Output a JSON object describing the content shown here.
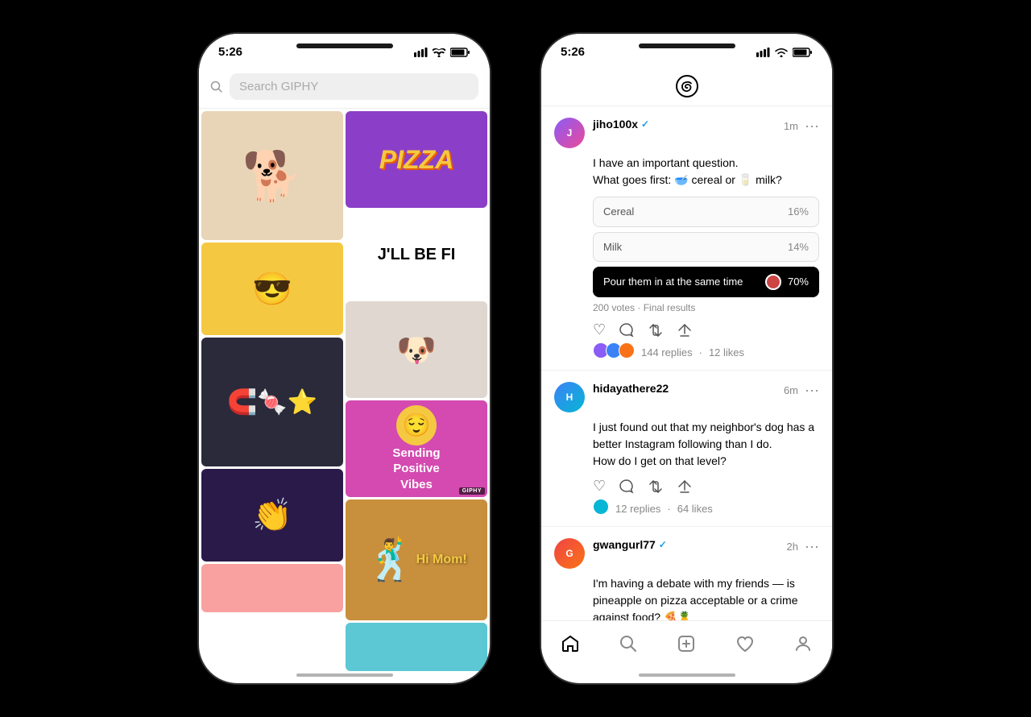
{
  "scene": {
    "bg_color": "#000000"
  },
  "giphy_phone": {
    "status_time": "5:26",
    "search_placeholder": "Search GIPHY",
    "gifs_col1": [
      {
        "id": "dog",
        "label": "Dog with glasses"
      },
      {
        "id": "girl",
        "label": "Girl with sunglasses"
      },
      {
        "id": "magnets",
        "label": "Magnet art"
      },
      {
        "id": "woman",
        "label": "Woman clapping"
      },
      {
        "id": "bottom1",
        "label": "Colorful bottom"
      }
    ],
    "gifs_col2": [
      {
        "id": "pizza",
        "label": "Pizza slice"
      },
      {
        "id": "jll",
        "label": "JLL Be Fi text"
      },
      {
        "id": "pom",
        "label": "Pomeranian dog"
      },
      {
        "id": "vibes",
        "label": "Sending Positive Vibes"
      },
      {
        "id": "himom",
        "label": "Hi Mom"
      },
      {
        "id": "bottom2",
        "label": "Colorful bottom 2"
      }
    ],
    "vibes_text": "Sending\nPositive\nVibes",
    "jll_text": "J'LL BE FI",
    "pizza_text": "PIZZA",
    "himom_text": "Hi Mom!"
  },
  "threads_phone": {
    "status_time": "5:26",
    "logo_label": "Threads",
    "posts": [
      {
        "id": "post1",
        "username": "jiho100x",
        "verified": true,
        "time": "1m",
        "body_line1": "I have an important question.",
        "body_line2": "What goes first: 🥣 cereal or 🥛 milk?",
        "has_poll": true,
        "poll_options": [
          {
            "label": "Cereal",
            "percent": "16%",
            "highlighted": false
          },
          {
            "label": "Milk",
            "percent": "14%",
            "highlighted": false
          },
          {
            "label": "Pour them in at the same time",
            "percent": "70%",
            "highlighted": true
          }
        ],
        "poll_meta": "200 votes · Final results",
        "replies": "144 replies",
        "likes": "12 likes"
      },
      {
        "id": "post2",
        "username": "hidayathere22",
        "verified": false,
        "time": "6m",
        "body_line1": "I just found out that my neighbor's dog has a",
        "body_line2": "better Instagram following than I do.",
        "body_line3": "How do I get on that level?",
        "has_poll": false,
        "replies": "12 replies",
        "likes": "64 likes"
      },
      {
        "id": "post3",
        "username": "gwangurl77",
        "verified": true,
        "time": "2h",
        "body_line1": "I'm having a debate with my friends — is",
        "body_line2": "pineapple on pizza acceptable or a crime",
        "body_line3": "against food? 🍕🍍",
        "has_poll": false,
        "replies": "",
        "likes": ""
      }
    ],
    "nav": {
      "home": "🏠",
      "search": "🔍",
      "compose": "✏️",
      "heart": "♡",
      "profile": "👤"
    },
    "more_icon": "···",
    "actions": {
      "like": "♡",
      "comment": "💬",
      "repost": "🔁",
      "share": "📤"
    }
  }
}
